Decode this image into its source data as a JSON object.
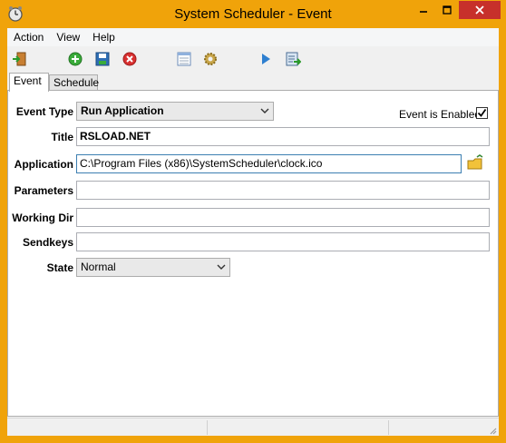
{
  "window": {
    "title": "System Scheduler - Event"
  },
  "colors": {
    "title_bar": "#f0a30a",
    "close_button": "#c7302b"
  },
  "menu": [
    "Action",
    "View",
    "Help"
  ],
  "toolbar": {
    "icons": [
      "exit-icon",
      "add-icon",
      "save-icon",
      "delete-icon",
      "calendar-icon",
      "settings-gear-icon",
      "run-icon",
      "export-icon"
    ]
  },
  "tabs": [
    {
      "label": "Event",
      "active": true
    },
    {
      "label": "Schedule",
      "active": false
    }
  ],
  "form": {
    "event_type": {
      "label": "Event Type",
      "value": "Run Application"
    },
    "enabled": {
      "label": "Event is Enabled",
      "checked": true
    },
    "title": {
      "label": "Title",
      "value": "RSLOAD.NET"
    },
    "application": {
      "label": "Application",
      "value": "C:\\Program Files (x86)\\SystemScheduler\\clock.ico"
    },
    "parameters": {
      "label": "Parameters",
      "value": ""
    },
    "working_dir": {
      "label": "Working Dir",
      "value": ""
    },
    "sendkeys": {
      "label": "Sendkeys",
      "value": ""
    },
    "state": {
      "label": "State",
      "value": "Normal"
    }
  }
}
